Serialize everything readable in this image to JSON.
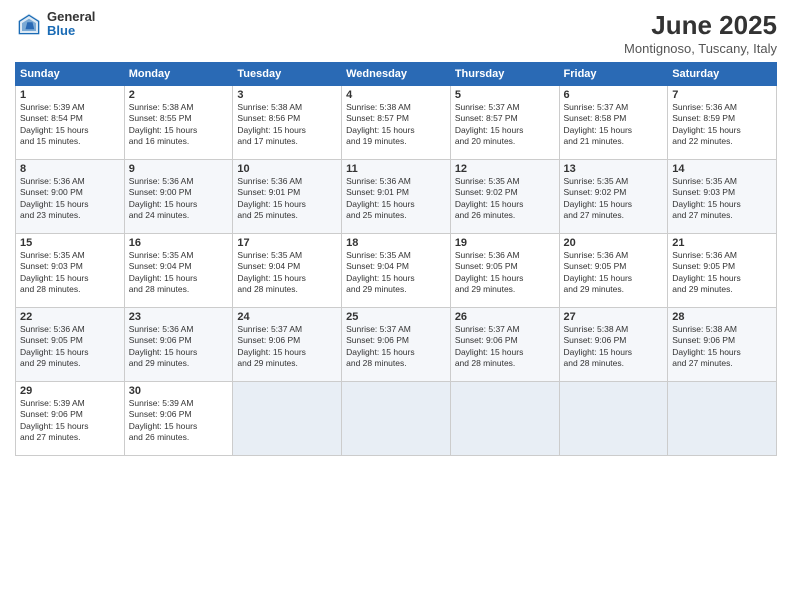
{
  "logo": {
    "general": "General",
    "blue": "Blue"
  },
  "title": "June 2025",
  "subtitle": "Montignoso, Tuscany, Italy",
  "weekdays": [
    "Sunday",
    "Monday",
    "Tuesday",
    "Wednesday",
    "Thursday",
    "Friday",
    "Saturday"
  ],
  "weeks": [
    [
      {
        "day": "1",
        "info": "Sunrise: 5:39 AM\nSunset: 8:54 PM\nDaylight: 15 hours\nand 15 minutes."
      },
      {
        "day": "2",
        "info": "Sunrise: 5:38 AM\nSunset: 8:55 PM\nDaylight: 15 hours\nand 16 minutes."
      },
      {
        "day": "3",
        "info": "Sunrise: 5:38 AM\nSunset: 8:56 PM\nDaylight: 15 hours\nand 17 minutes."
      },
      {
        "day": "4",
        "info": "Sunrise: 5:38 AM\nSunset: 8:57 PM\nDaylight: 15 hours\nand 19 minutes."
      },
      {
        "day": "5",
        "info": "Sunrise: 5:37 AM\nSunset: 8:57 PM\nDaylight: 15 hours\nand 20 minutes."
      },
      {
        "day": "6",
        "info": "Sunrise: 5:37 AM\nSunset: 8:58 PM\nDaylight: 15 hours\nand 21 minutes."
      },
      {
        "day": "7",
        "info": "Sunrise: 5:36 AM\nSunset: 8:59 PM\nDaylight: 15 hours\nand 22 minutes."
      }
    ],
    [
      {
        "day": "8",
        "info": "Sunrise: 5:36 AM\nSunset: 9:00 PM\nDaylight: 15 hours\nand 23 minutes."
      },
      {
        "day": "9",
        "info": "Sunrise: 5:36 AM\nSunset: 9:00 PM\nDaylight: 15 hours\nand 24 minutes."
      },
      {
        "day": "10",
        "info": "Sunrise: 5:36 AM\nSunset: 9:01 PM\nDaylight: 15 hours\nand 25 minutes."
      },
      {
        "day": "11",
        "info": "Sunrise: 5:36 AM\nSunset: 9:01 PM\nDaylight: 15 hours\nand 25 minutes."
      },
      {
        "day": "12",
        "info": "Sunrise: 5:35 AM\nSunset: 9:02 PM\nDaylight: 15 hours\nand 26 minutes."
      },
      {
        "day": "13",
        "info": "Sunrise: 5:35 AM\nSunset: 9:02 PM\nDaylight: 15 hours\nand 27 minutes."
      },
      {
        "day": "14",
        "info": "Sunrise: 5:35 AM\nSunset: 9:03 PM\nDaylight: 15 hours\nand 27 minutes."
      }
    ],
    [
      {
        "day": "15",
        "info": "Sunrise: 5:35 AM\nSunset: 9:03 PM\nDaylight: 15 hours\nand 28 minutes."
      },
      {
        "day": "16",
        "info": "Sunrise: 5:35 AM\nSunset: 9:04 PM\nDaylight: 15 hours\nand 28 minutes."
      },
      {
        "day": "17",
        "info": "Sunrise: 5:35 AM\nSunset: 9:04 PM\nDaylight: 15 hours\nand 28 minutes."
      },
      {
        "day": "18",
        "info": "Sunrise: 5:35 AM\nSunset: 9:04 PM\nDaylight: 15 hours\nand 29 minutes."
      },
      {
        "day": "19",
        "info": "Sunrise: 5:36 AM\nSunset: 9:05 PM\nDaylight: 15 hours\nand 29 minutes."
      },
      {
        "day": "20",
        "info": "Sunrise: 5:36 AM\nSunset: 9:05 PM\nDaylight: 15 hours\nand 29 minutes."
      },
      {
        "day": "21",
        "info": "Sunrise: 5:36 AM\nSunset: 9:05 PM\nDaylight: 15 hours\nand 29 minutes."
      }
    ],
    [
      {
        "day": "22",
        "info": "Sunrise: 5:36 AM\nSunset: 9:05 PM\nDaylight: 15 hours\nand 29 minutes."
      },
      {
        "day": "23",
        "info": "Sunrise: 5:36 AM\nSunset: 9:06 PM\nDaylight: 15 hours\nand 29 minutes."
      },
      {
        "day": "24",
        "info": "Sunrise: 5:37 AM\nSunset: 9:06 PM\nDaylight: 15 hours\nand 29 minutes."
      },
      {
        "day": "25",
        "info": "Sunrise: 5:37 AM\nSunset: 9:06 PM\nDaylight: 15 hours\nand 28 minutes."
      },
      {
        "day": "26",
        "info": "Sunrise: 5:37 AM\nSunset: 9:06 PM\nDaylight: 15 hours\nand 28 minutes."
      },
      {
        "day": "27",
        "info": "Sunrise: 5:38 AM\nSunset: 9:06 PM\nDaylight: 15 hours\nand 28 minutes."
      },
      {
        "day": "28",
        "info": "Sunrise: 5:38 AM\nSunset: 9:06 PM\nDaylight: 15 hours\nand 27 minutes."
      }
    ],
    [
      {
        "day": "29",
        "info": "Sunrise: 5:39 AM\nSunset: 9:06 PM\nDaylight: 15 hours\nand 27 minutes."
      },
      {
        "day": "30",
        "info": "Sunrise: 5:39 AM\nSunset: 9:06 PM\nDaylight: 15 hours\nand 26 minutes."
      },
      {
        "day": "",
        "info": ""
      },
      {
        "day": "",
        "info": ""
      },
      {
        "day": "",
        "info": ""
      },
      {
        "day": "",
        "info": ""
      },
      {
        "day": "",
        "info": ""
      }
    ]
  ]
}
